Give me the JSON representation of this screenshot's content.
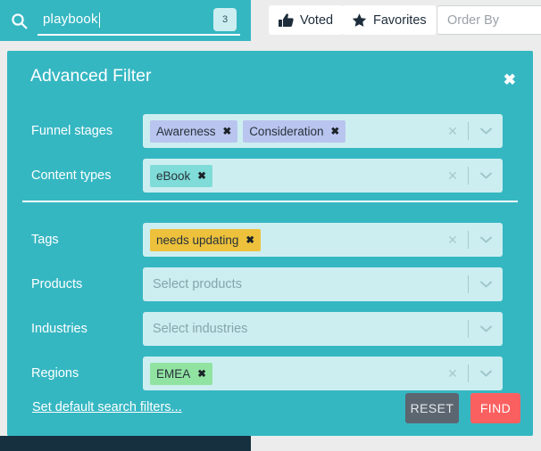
{
  "search": {
    "icon": "search-icon",
    "value": "playbook",
    "result_count": "3"
  },
  "toolbar": {
    "voted_label": "Voted",
    "voted_icon": "thumbs-up-icon",
    "favorites_label": "Favorites",
    "favorites_icon": "star-icon",
    "order_by_placeholder": "Order By"
  },
  "panel": {
    "title": "Advanced Filter",
    "close_icon": "close-icon",
    "rows": [
      {
        "label": "Funnel stages",
        "placeholder": "",
        "has_clear": true,
        "chips": [
          {
            "text": "Awareness",
            "color": "#b9c5ef"
          },
          {
            "text": "Consideration",
            "color": "#b9c5ef"
          }
        ]
      },
      {
        "label": "Content types",
        "placeholder": "",
        "has_clear": true,
        "chips": [
          {
            "text": "eBook",
            "color": "#7fdcd8"
          }
        ]
      },
      {
        "label": "Tags",
        "placeholder": "",
        "has_clear": true,
        "chips": [
          {
            "text": "needs updating",
            "color": "#eec13c"
          }
        ]
      },
      {
        "label": "Products",
        "placeholder": "Select products",
        "has_clear": false,
        "chips": []
      },
      {
        "label": "Industries",
        "placeholder": "Select industries",
        "has_clear": false,
        "chips": []
      },
      {
        "label": "Regions",
        "placeholder": "",
        "has_clear": true,
        "chips": [
          {
            "text": "EMEA",
            "color": "#91e3a2"
          }
        ]
      }
    ],
    "chip_remove_glyph": "✖",
    "clear_glyph": "✕",
    "footer": {
      "default_filters_link": "Set default search filters...",
      "reset_label": "RESET",
      "find_label": "FIND"
    }
  },
  "colors": {
    "teal": "#35b7c2",
    "field": "#cdeef0",
    "reset": "#5c6670",
    "find": "#fb6060",
    "navy": "#16303f"
  }
}
